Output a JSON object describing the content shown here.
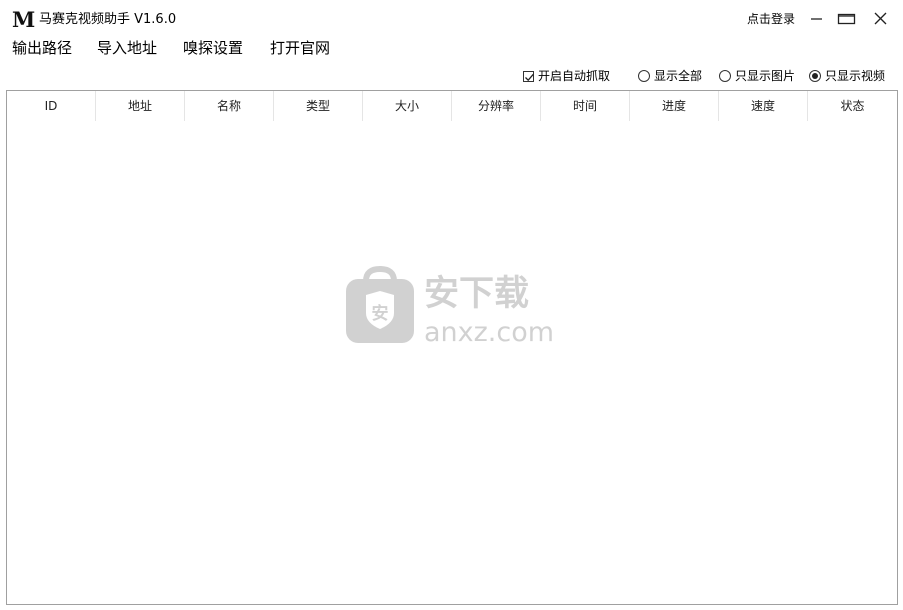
{
  "app": {
    "logo_text": "M",
    "title": "马赛克视频助手 V1.6.0",
    "login_label": "点击登录"
  },
  "menu": {
    "items": [
      "输出路径",
      "导入地址",
      "嗅探设置",
      "打开官网"
    ]
  },
  "options": {
    "auto_capture": {
      "label": "开启自动抓取",
      "checked": true
    },
    "filter": {
      "choices": [
        "显示全部",
        "只显示图片",
        "只显示视频"
      ],
      "selected": "只显示视频"
    }
  },
  "table": {
    "columns": [
      "ID",
      "地址",
      "名称",
      "类型",
      "大小",
      "分辨率",
      "时间",
      "进度",
      "速度",
      "状态"
    ],
    "rows": []
  },
  "watermark": {
    "badge": "安",
    "brand": "安下载",
    "domain": "anxz.com"
  },
  "icons": {
    "minimize": "minimize-icon",
    "maximize": "maximize-icon",
    "close": "close-icon"
  }
}
